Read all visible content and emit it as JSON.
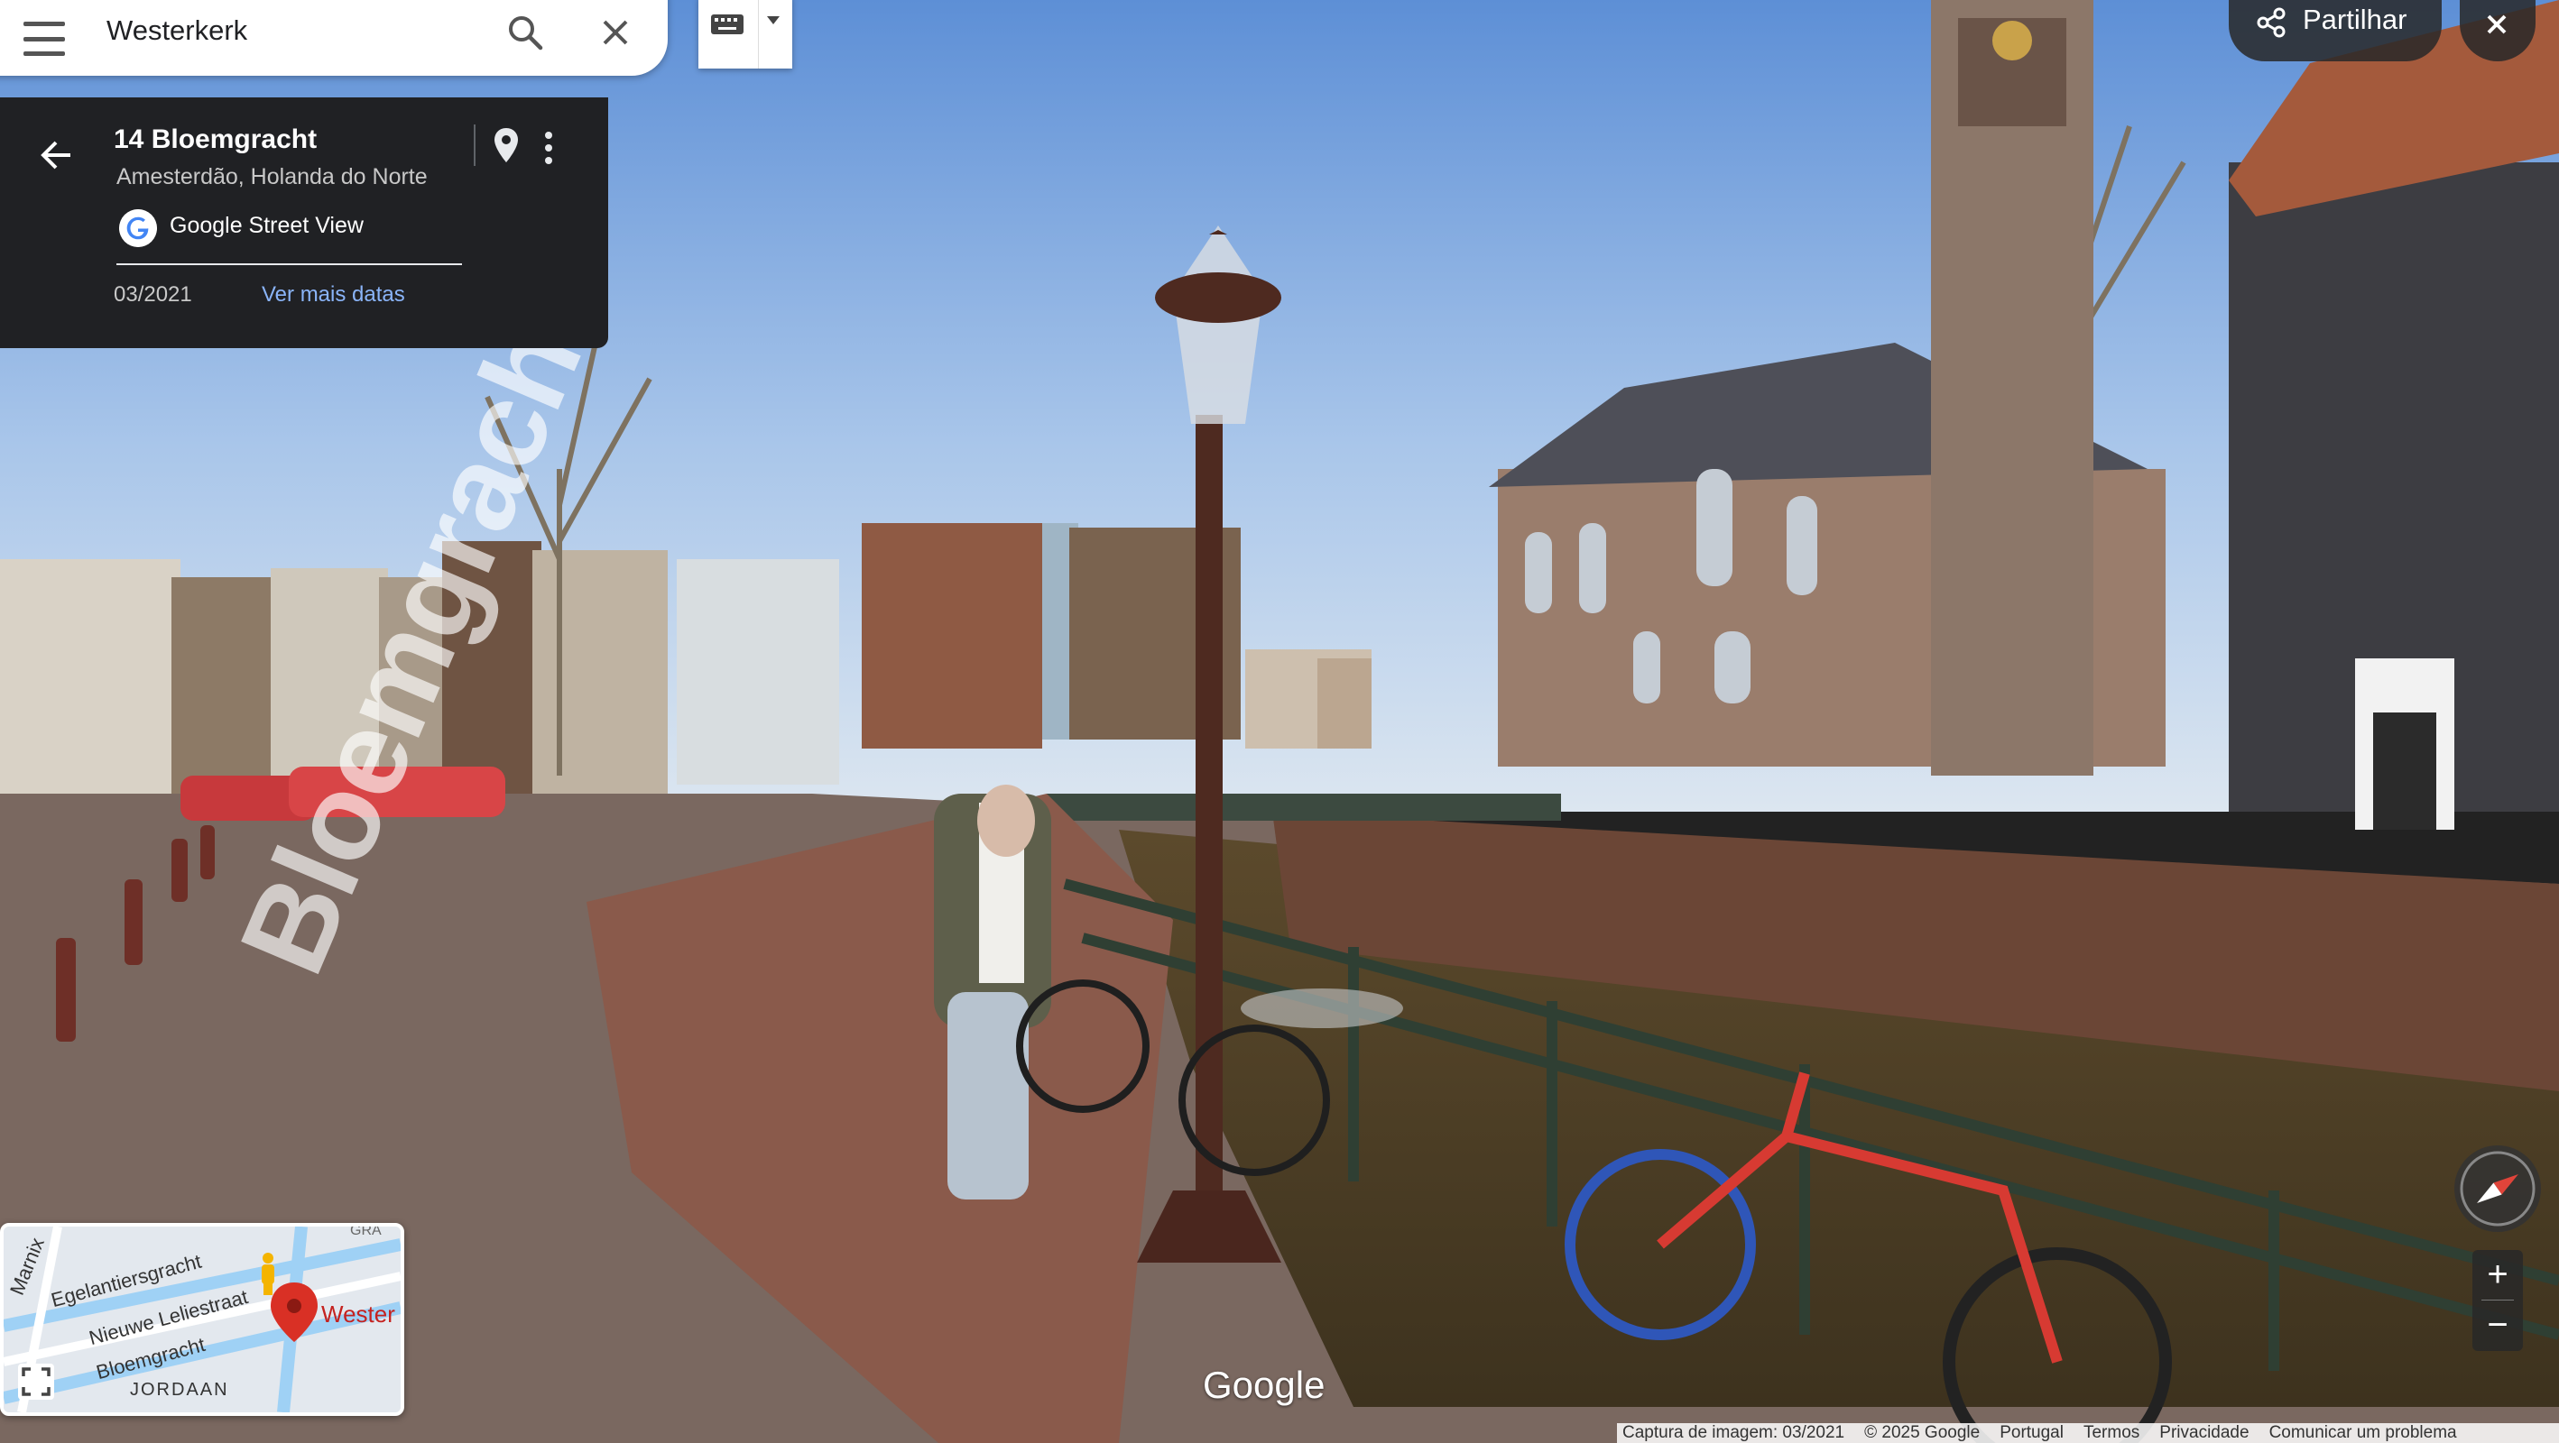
{
  "search": {
    "query": "Westerkerk"
  },
  "card": {
    "title": "14 Bloemgracht",
    "subtitle": "Amesterdão, Holanda do Norte",
    "source": "Google Street View",
    "date": "03/2021",
    "more_dates": "Ver mais datas"
  },
  "share": {
    "label": "Partilhar"
  },
  "scene": {
    "street_label": "Bloemgracht",
    "watermark": "Google"
  },
  "zoom": {
    "in": "+",
    "out": "−"
  },
  "minimap": {
    "labels": [
      "Marnix",
      "Egelantiersgracht",
      "Nieuwe Leliestraat",
      "Bloemgracht",
      "JORDAAN",
      "Wester",
      "GRA"
    ]
  },
  "footer": {
    "capture": "Captura de imagem: 03/2021",
    "copyright": "© 2025 Google",
    "region": "Portugal",
    "terms": "Termos",
    "privacy": "Privacidade",
    "report": "Comunicar um problema"
  },
  "icons": [
    "menu-icon",
    "search-icon",
    "close-icon",
    "keyboard-icon",
    "back-arrow-icon",
    "pin-icon",
    "more-vert-icon",
    "google-g-icon",
    "share-icon",
    "compass-icon",
    "expand-icon",
    "pegman-icon",
    "map-marker-icon"
  ]
}
